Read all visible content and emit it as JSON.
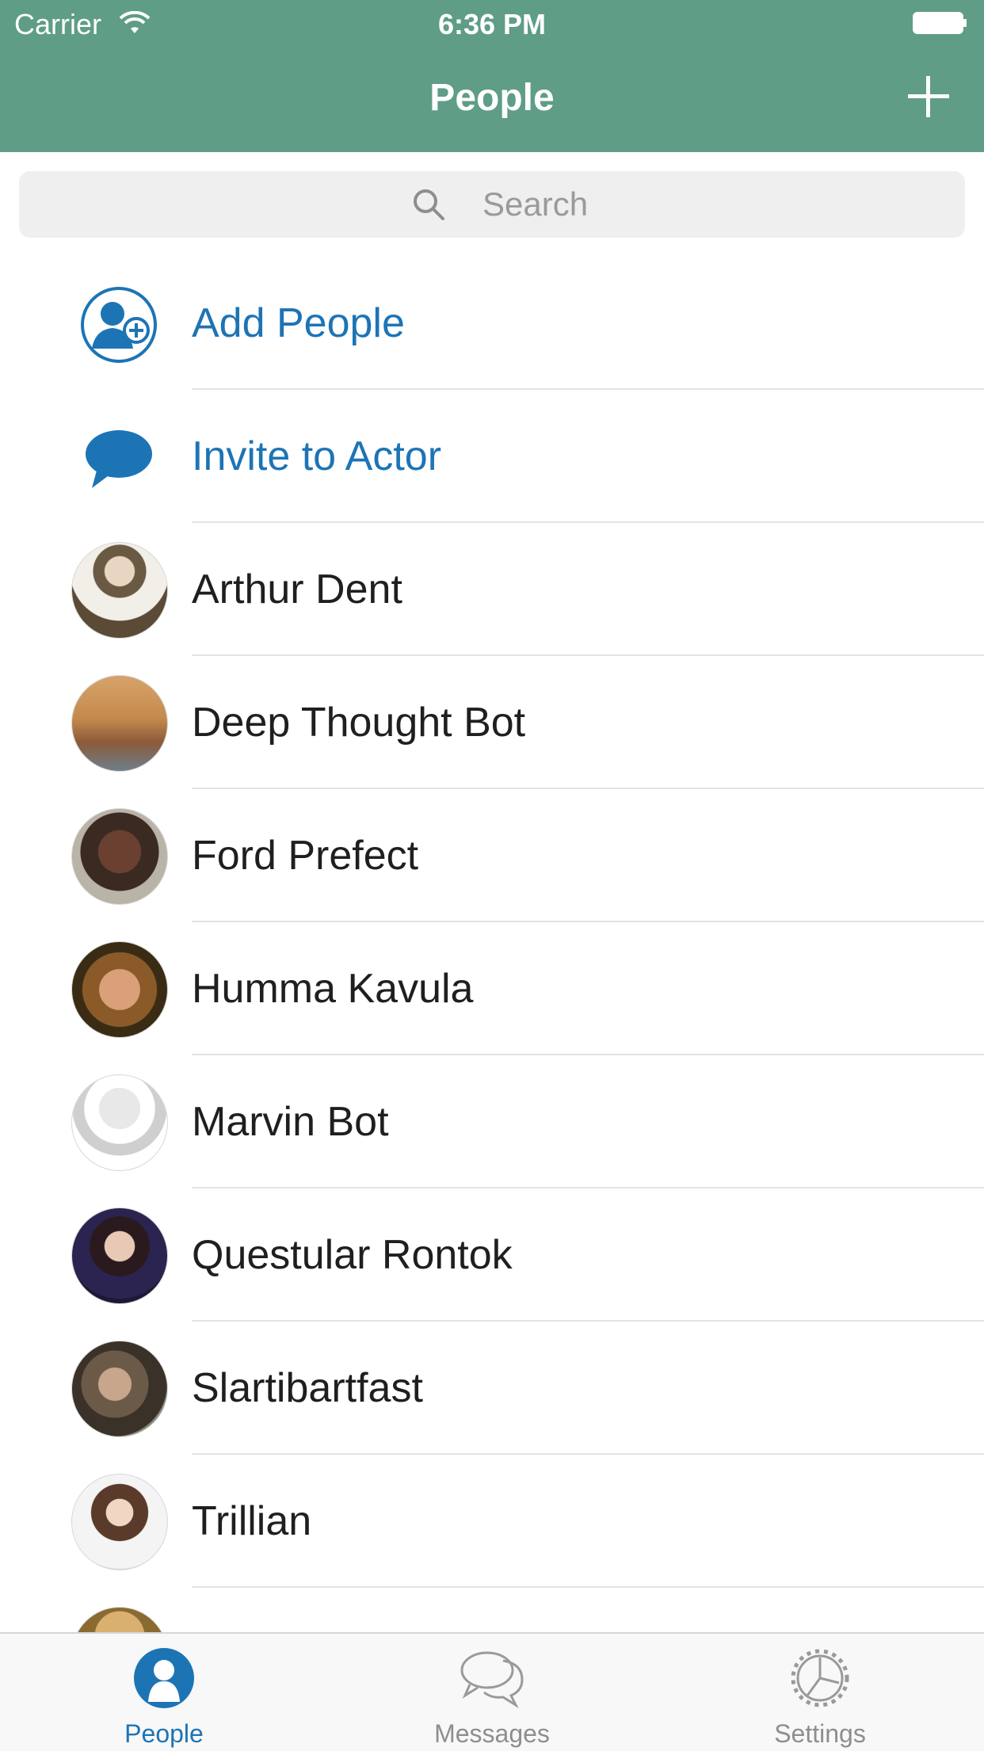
{
  "status": {
    "carrier": "Carrier",
    "time": "6:36 PM"
  },
  "header": {
    "title": "People"
  },
  "search": {
    "placeholder": "Search"
  },
  "actions": [
    {
      "label": "Add People",
      "icon": "add-person-icon"
    },
    {
      "label": "Invite to Actor",
      "icon": "speech-bubble-icon"
    }
  ],
  "contacts": [
    {
      "name": "Arthur Dent"
    },
    {
      "name": "Deep Thought Bot"
    },
    {
      "name": "Ford Prefect"
    },
    {
      "name": "Humma Kavula"
    },
    {
      "name": "Marvin Bot"
    },
    {
      "name": "Questular Rontok"
    },
    {
      "name": "Slartibartfast"
    },
    {
      "name": "Trillian"
    }
  ],
  "tabs": [
    {
      "label": "People",
      "icon": "person-icon",
      "active": true
    },
    {
      "label": "Messages",
      "icon": "chat-bubbles-icon",
      "active": false
    },
    {
      "label": "Settings",
      "icon": "gear-icon",
      "active": false
    }
  ],
  "colors": {
    "header": "#5f9d86",
    "accent": "#1d74b5"
  }
}
